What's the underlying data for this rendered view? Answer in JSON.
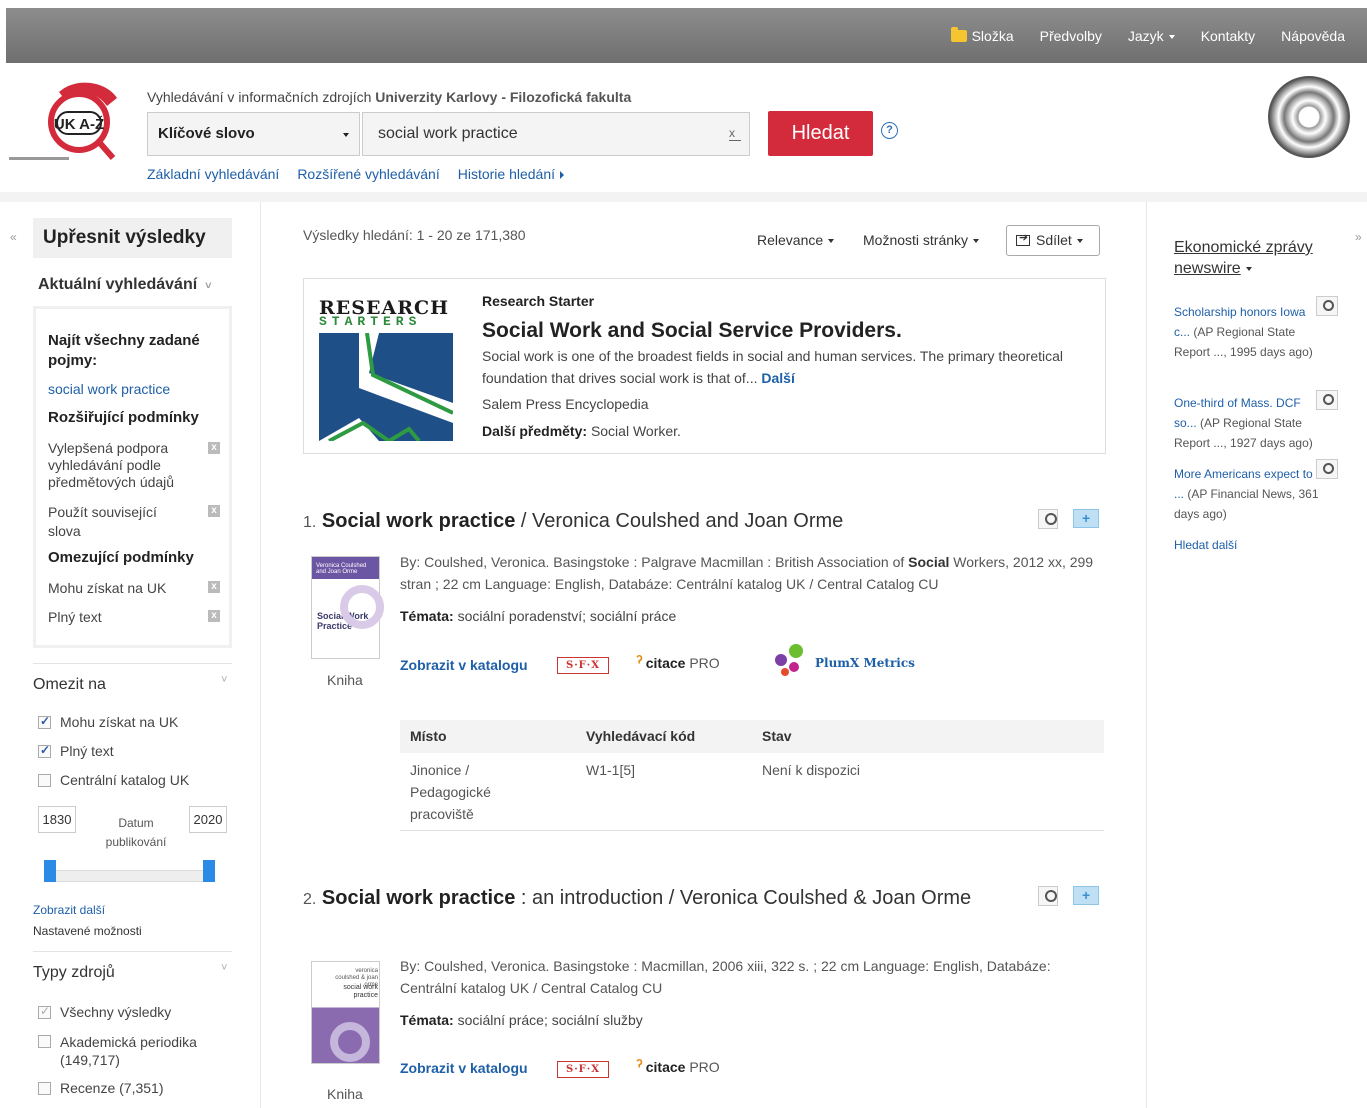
{
  "topbar": {
    "folder": "Složka",
    "preferences": "Předvolby",
    "language": "Jazyk",
    "contact": "Kontakty",
    "help": "Nápověda"
  },
  "header": {
    "tagline_prefix": "Vyhledávání v informačních zdrojích",
    "tagline_bold": "Univerzity Karlovy - Filozofická fakulta",
    "search_field": "Klíčové slovo",
    "search_value": "social work practice",
    "search_button": "Hledat",
    "help": "?",
    "links": {
      "basic": "Základní vyhledávání",
      "advanced": "Rozšířené vyhledávání",
      "history": "Historie hledání"
    },
    "logo_text": "UK A-Ž"
  },
  "left": {
    "refine_title": "Upřesnit výsledky",
    "current_search": "Aktuální vyhledávání",
    "find_all": "Najít všechny zadané pojmy:",
    "query": "social work practice",
    "expanders_title": "Rozšiřující podmínky",
    "expander1": "Vylepšená podpora vyhledávání podle předmětových údajů",
    "expander2": "Použít související slova",
    "limiters_title": "Omezující podmínky",
    "limiter1": "Mohu získat na UK",
    "limiter2": "Plný text",
    "limit_to": "Omezit na",
    "checkbox1": "Mohu získat na UK",
    "checkbox2": "Plný text",
    "checkbox3": "Centrální katalog UK",
    "year_from": "1830",
    "year_to": "2020",
    "date_label": "Datum publikování",
    "show_more": "Zobrazit další",
    "settings": "Nastavené možnosti",
    "source_types": "Typy zdrojů",
    "source1": "Všechny výsledky",
    "source2": "Akademická periodika (149,717)",
    "source3": "Recenze (7,351)"
  },
  "center": {
    "results_count": "Výsledky hledání: 1 - 20 ze 171,380",
    "relevance": "Relevance",
    "page_options": "Možnosti stránky",
    "share": "Sdílet",
    "research_starter": {
      "logo_line1": "RESEARCH",
      "logo_line2": "STARTERS",
      "label": "Research Starter",
      "title": "Social Work and Social Service Providers.",
      "description": "Social work is one of the broadest fields in social and human services. The primary theoretical foundation that drives social work is that of...",
      "more": "Další",
      "source": "Salem Press Encyclopedia",
      "subjects_label": "Další předměty:",
      "subjects": "Social Worker."
    },
    "results": [
      {
        "num": "1.",
        "title": "Social work practice",
        "rest": "/ Veronica Coulshed and Joan Orme",
        "meta_prefix": "By: Coulshed, Veronica. Basingstoke : Palgrave Macmillan : British Association of",
        "meta_bold": "Social",
        "meta_suffix": "Workers, 2012 xx, 299 stran ; 22 cm Language: English, Databáze: Centrální katalog UK / Central Catalog CU",
        "topics_label": "Témata:",
        "topics": "sociální poradenství; sociální práce",
        "catalog": "Zobrazit v katalogu",
        "sfx": "S·F·X",
        "citace": "citace",
        "citace_pro": "PRO",
        "plumx": "PlumX Metrics",
        "type": "Kniha",
        "cover_title": "Social Work Practice",
        "cover_authors": "Veronica Coulshed and Joan Orme"
      },
      {
        "num": "2.",
        "title": "Social work practice",
        "rest": ": an introduction / Veronica Coulshed & Joan Orme",
        "meta": "By: Coulshed, Veronica. Basingstoke : Macmillan, 2006 xiii, 322 s. ; 22 cm Language: English, Databáze: Centrální katalog UK / Central Catalog CU",
        "topics_label": "Témata:",
        "topics": "sociální práce; sociální služby",
        "catalog": "Zobrazit v katalogu",
        "sfx": "S·F·X",
        "citace": "citace",
        "citace_pro": "PRO",
        "type": "Kniha",
        "cover_title": "social work practice",
        "cover_authors": "veronica coulshed & joan orme"
      }
    ],
    "holdings": {
      "headers": [
        "Místo",
        "Vyhledávací kód",
        "Stav"
      ],
      "location": "Jinonice / Pedagogické pracoviště",
      "code": "W1-1[5]",
      "status": "Není k dispozici"
    }
  },
  "right": {
    "title": "Ekonomické zprávy newswire",
    "news": [
      {
        "link": "Scholarship honors Iowa c...",
        "source": "(AP Regional State Report ..., 1995 days ago)"
      },
      {
        "link": "One-third of Mass. DCF so...",
        "source": "(AP Regional State Report ..., 1927 days ago)"
      },
      {
        "link": "More Americans expect to ...",
        "source": "(AP Financial News, 361 days ago)"
      }
    ],
    "more": "Hledat další"
  },
  "colors": {
    "search_button": "#d32b3b",
    "link": "#1e5fa8",
    "topbar": "#7a7a7a"
  }
}
